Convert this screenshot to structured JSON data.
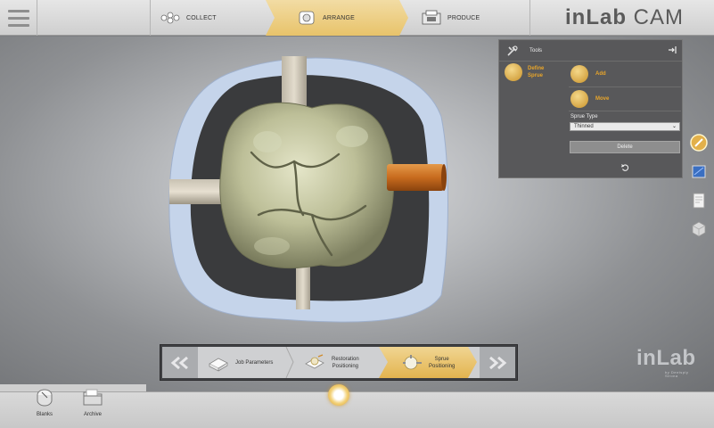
{
  "topbar": {
    "menu_icon": "hamburger-icon",
    "steps": [
      {
        "label": "COLLECT",
        "icon": "collect-icon",
        "active": false
      },
      {
        "label": "ARRANGE",
        "icon": "arrange-icon",
        "active": true
      },
      {
        "label": "PRODUCE",
        "icon": "produce-icon",
        "active": false
      }
    ],
    "brand": {
      "bold": "inLab",
      "light": " CAM"
    }
  },
  "tools_panel": {
    "title": "Tools",
    "pin_icon": "pin-panel-icon",
    "define_sprue": "Define\nSprue",
    "add_label": "Add",
    "move_label": "Move",
    "sprue_type_label": "Sprue Type",
    "sprue_type_value": "Thinned",
    "delete_label": "Delete",
    "undo_icon": "undo-icon"
  },
  "side_icons": [
    "sprue-tool-icon",
    "screen-icon",
    "document-icon",
    "block-icon"
  ],
  "step_nav": {
    "prev_icon": "double-chevron-left-icon",
    "next_icon": "double-chevron-right-icon",
    "steps": [
      {
        "label": "Job Parameters",
        "active": false
      },
      {
        "label": "Restoration\nPositioning",
        "active": false
      },
      {
        "label": "Sprue\nPositioning",
        "active": true
      }
    ]
  },
  "watermark": {
    "text": "inLab",
    "by": "by Dentsply\nSirona"
  },
  "bottombar": {
    "blanks_label": "Blanks",
    "archive_label": "Archive",
    "center_icon": "rotate-view-icon"
  },
  "colors": {
    "accent": "#e8c36a",
    "panel": "#58585a",
    "blank_border": "#c4d3ea",
    "tooth": "#bfc09a",
    "sprue_active": "#c86b1e"
  }
}
